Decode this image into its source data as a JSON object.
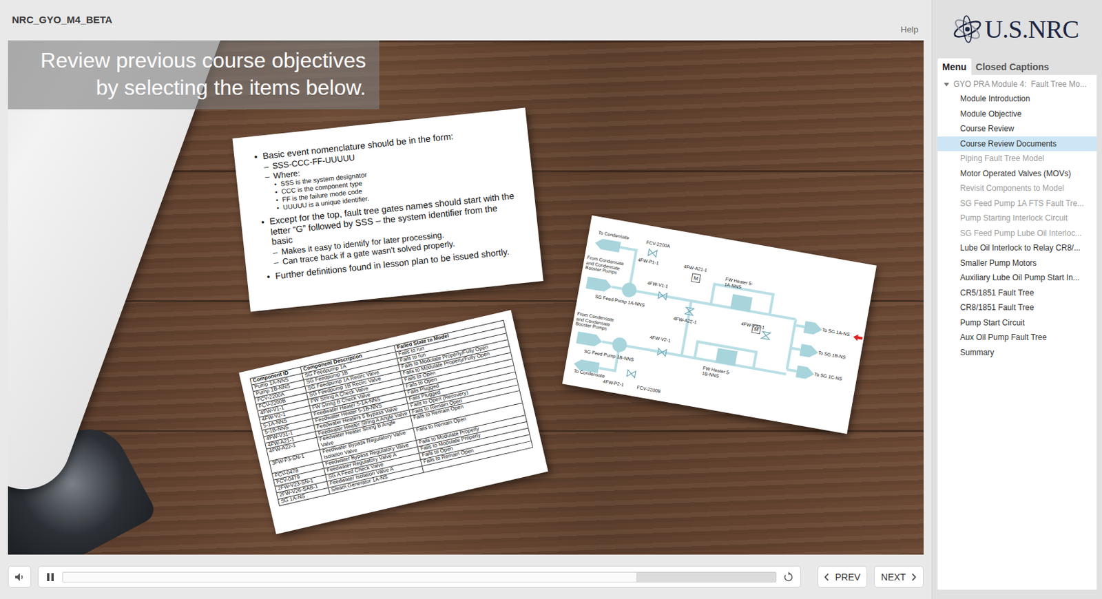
{
  "window": {
    "title": "NRC_GYO_M4_BETA",
    "help": "Help"
  },
  "logo": {
    "text": "U.S.NRC"
  },
  "panel_tabs": [
    {
      "label": "Menu",
      "selected": true
    },
    {
      "label": "Closed Captions",
      "selected": false
    }
  ],
  "menu": {
    "header": {
      "label": "GYO PRA Module 4:  Fault Tree Mo...",
      "expanded": true
    },
    "items": [
      {
        "label": "Module Introduction",
        "selected": false,
        "disabled": false
      },
      {
        "label": "Module Objective",
        "selected": false,
        "disabled": false
      },
      {
        "label": "Course Review",
        "selected": false,
        "disabled": false
      },
      {
        "label": "Course Review Documents",
        "selected": true,
        "disabled": false
      },
      {
        "label": "Piping Fault Tree Model",
        "selected": false,
        "disabled": true
      },
      {
        "label": "Motor Operated Valves (MOVs)",
        "selected": false,
        "disabled": false
      },
      {
        "label": "Revisit Components to Model",
        "selected": false,
        "disabled": true
      },
      {
        "label": "SG Feed Pump 1A FTS Fault Tre...",
        "selected": false,
        "disabled": true
      },
      {
        "label": "Pump Starting Interlock Circuit",
        "selected": false,
        "disabled": true
      },
      {
        "label": "SG Feed Pump Lube Oil Interloc...",
        "selected": false,
        "disabled": true
      },
      {
        "label": "Lube Oil Interlock to Relay CR8/...",
        "selected": false,
        "disabled": false
      },
      {
        "label": "Smaller Pump Motors",
        "selected": false,
        "disabled": false
      },
      {
        "label": "Auxiliary Lube Oil Pump Start In...",
        "selected": false,
        "disabled": false
      },
      {
        "label": "CR5/1851 Fault Tree",
        "selected": false,
        "disabled": false
      },
      {
        "label": "CR8/1851 Fault Tree",
        "selected": false,
        "disabled": false
      },
      {
        "label": "Pump Start Circuit",
        "selected": false,
        "disabled": false
      },
      {
        "label": "Aux Oil Pump Fault Tree",
        "selected": false,
        "disabled": false
      },
      {
        "label": "Summary",
        "selected": false,
        "disabled": false
      }
    ]
  },
  "slide": {
    "heading": [
      "Review previous course objectives",
      "by selecting the items below."
    ],
    "notes_doc": {
      "bullets": [
        {
          "marker": "•",
          "text": "Basic event nomenclature should be in the form:",
          "sub": [
            {
              "marker": "–",
              "text": "SSS-CCC-FF-UUUUU",
              "sub": []
            },
            {
              "marker": "–",
              "text": "Where:",
              "sub": [
                {
                  "marker": "•",
                  "text": "SSS is the system designator"
                },
                {
                  "marker": "•",
                  "text": "CCC is the component type"
                },
                {
                  "marker": "•",
                  "text": "FF is the failure mode code"
                },
                {
                  "marker": "•",
                  "text": "UUUUU is a unique identifier."
                }
              ]
            }
          ]
        },
        {
          "marker": "•",
          "text": "Except for the top, fault tree gates names should start with the letter “G” followed by SSS – the system identifier from the basic",
          "sub": [
            {
              "marker": "–",
              "text": "Makes it easy to identify for later processing.",
              "sub": []
            },
            {
              "marker": "–",
              "text": "Can trace back if a gate wasn't solved properly.",
              "sub": []
            }
          ]
        },
        {
          "marker": "•",
          "text": "Further definitions found in lesson plan to be issued shortly.",
          "sub": []
        }
      ]
    },
    "table_doc": {
      "columns": [
        "Component ID",
        "Component Description",
        "Failed State to Model"
      ],
      "rows": [
        [
          "Pump 1A-NNS",
          "SG Feedpump 1A",
          "Fails to run"
        ],
        [
          "Pump 1B-NNS",
          "SG Feedpump 1B",
          "Fails to run"
        ],
        [
          "FCV-2200A",
          "SG Feedpump 1A Recirc Valve",
          "Fails to Modulate Properly/Fully Open"
        ],
        [
          "FCV-2200B",
          "SG Feedpump 1B Recirc Valve",
          "Fails to Modulate Properly/Fully Open"
        ],
        [
          "4FW-V1-1",
          "FW String A Check Valve",
          "Fails to Open"
        ],
        [
          "4FW-V2-1",
          "FW String B Check Valve",
          "Fails to Open"
        ],
        [
          "5-1A-NNS",
          "Feedwater Heater 5-1A-NNS",
          "Fails Plugged"
        ],
        [
          "5-1B-NNS",
          "Feedwater Heater 5-1B-NNS",
          "Fails Plugged"
        ],
        [
          "4FW-V31-1",
          "Feedwater Heaters 5 Bypass Valve",
          "Fails to Open (Recovery)"
        ],
        [
          "4FW-A21-1",
          "Feedwater Heater String A Angle Valve",
          "Fails to Remain Open"
        ],
        [
          "4FW-A22-1",
          "Feedwater Heater String B Angle Valve",
          "Fails to Remain Open"
        ],
        [
          "3FW-F3-SN-1",
          "Feedwater Bypass Regulatory Valve Isolation Valve",
          "Fails to Remain Open"
        ],
        [
          "FCV-0478",
          "Feedwater Bypass Regulatory Valve",
          "Fails to Modulate Properly"
        ],
        [
          "FCV-0479",
          "Feedwater Regulatory Valve A",
          "Fails to Modulate Properly"
        ],
        [
          "2FW-V23-SN-1",
          "SG A Feed Check Valve",
          "Fails to Open"
        ],
        [
          "2FW-V26-SAB-1",
          "Feedwater Isolation Valve A",
          "Fails to Remain Open"
        ],
        [
          "SG 1A-NS",
          "Steam Generator 1A-NS",
          ""
        ]
      ]
    },
    "diagram_doc": {
      "labels": [
        "To Condensate",
        "FCV-2200A",
        "4FW-P1-1",
        "From Condensate and Condensate Booster Pumps",
        "SG Feed Pump 1A-NNS",
        "4FW-V1-1",
        "4FW-A21-1",
        "FW Heater 5-1A-NNS",
        "4FW-V31-1",
        "4FW-A22-1",
        "FW Heater 5-1B-NNS",
        "To SG 1A-NS",
        "To SG 1B-NS",
        "To SG 1C-NS",
        "From Condensate and Condensate Booster Pumps",
        "4FW-V2-1",
        "SG Feed Pump 1B-NNS",
        "To Condensate",
        "4FW-P2-1",
        "FCV-2200B"
      ],
      "motors": [
        "M",
        "M"
      ]
    }
  },
  "player": {
    "muted": false,
    "playing": true,
    "progress": {
      "level": 0.806
    },
    "buttons": [
      {
        "label": "PREV",
        "kind": "prev"
      },
      {
        "label": "NEXT",
        "kind": "next"
      }
    ]
  }
}
